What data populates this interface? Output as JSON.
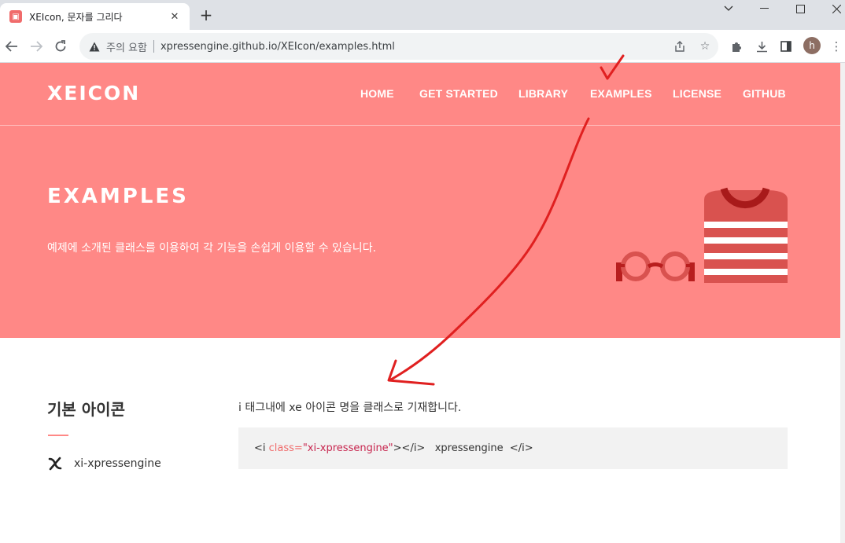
{
  "browser": {
    "tab_title": "XEIcon, 문자를 그리다",
    "security_text": "주의 요함",
    "url": "xpressengine.github.io/XEIcon/examples.html",
    "avatar_letter": "h"
  },
  "site": {
    "logo": "XEICON",
    "nav": [
      "HOME",
      "GET STARTED",
      "LIBRARY",
      "EXAMPLES",
      "LICENSE",
      "GITHUB"
    ]
  },
  "hero": {
    "title": "EXAMPLES",
    "description": "예제에 소개된 클래스를 이용하여 각 기능을 손쉽게 이용할 수 있습니다."
  },
  "section": {
    "title": "기본 아이콘",
    "item_label": "xi-xpressengine",
    "description": "i 태그내에 xe 아이콘 명을 클래스로 기재합니다.",
    "code": {
      "open": "<i ",
      "attr": "class=",
      "value": "\"xi-xpressengine\"",
      "close_tag": "></i>",
      "text": "   xpressengine  </i>"
    }
  },
  "colors": {
    "hero_bg": "#ff8886",
    "accent": "#f06b6b",
    "annotation": "#e02020"
  }
}
